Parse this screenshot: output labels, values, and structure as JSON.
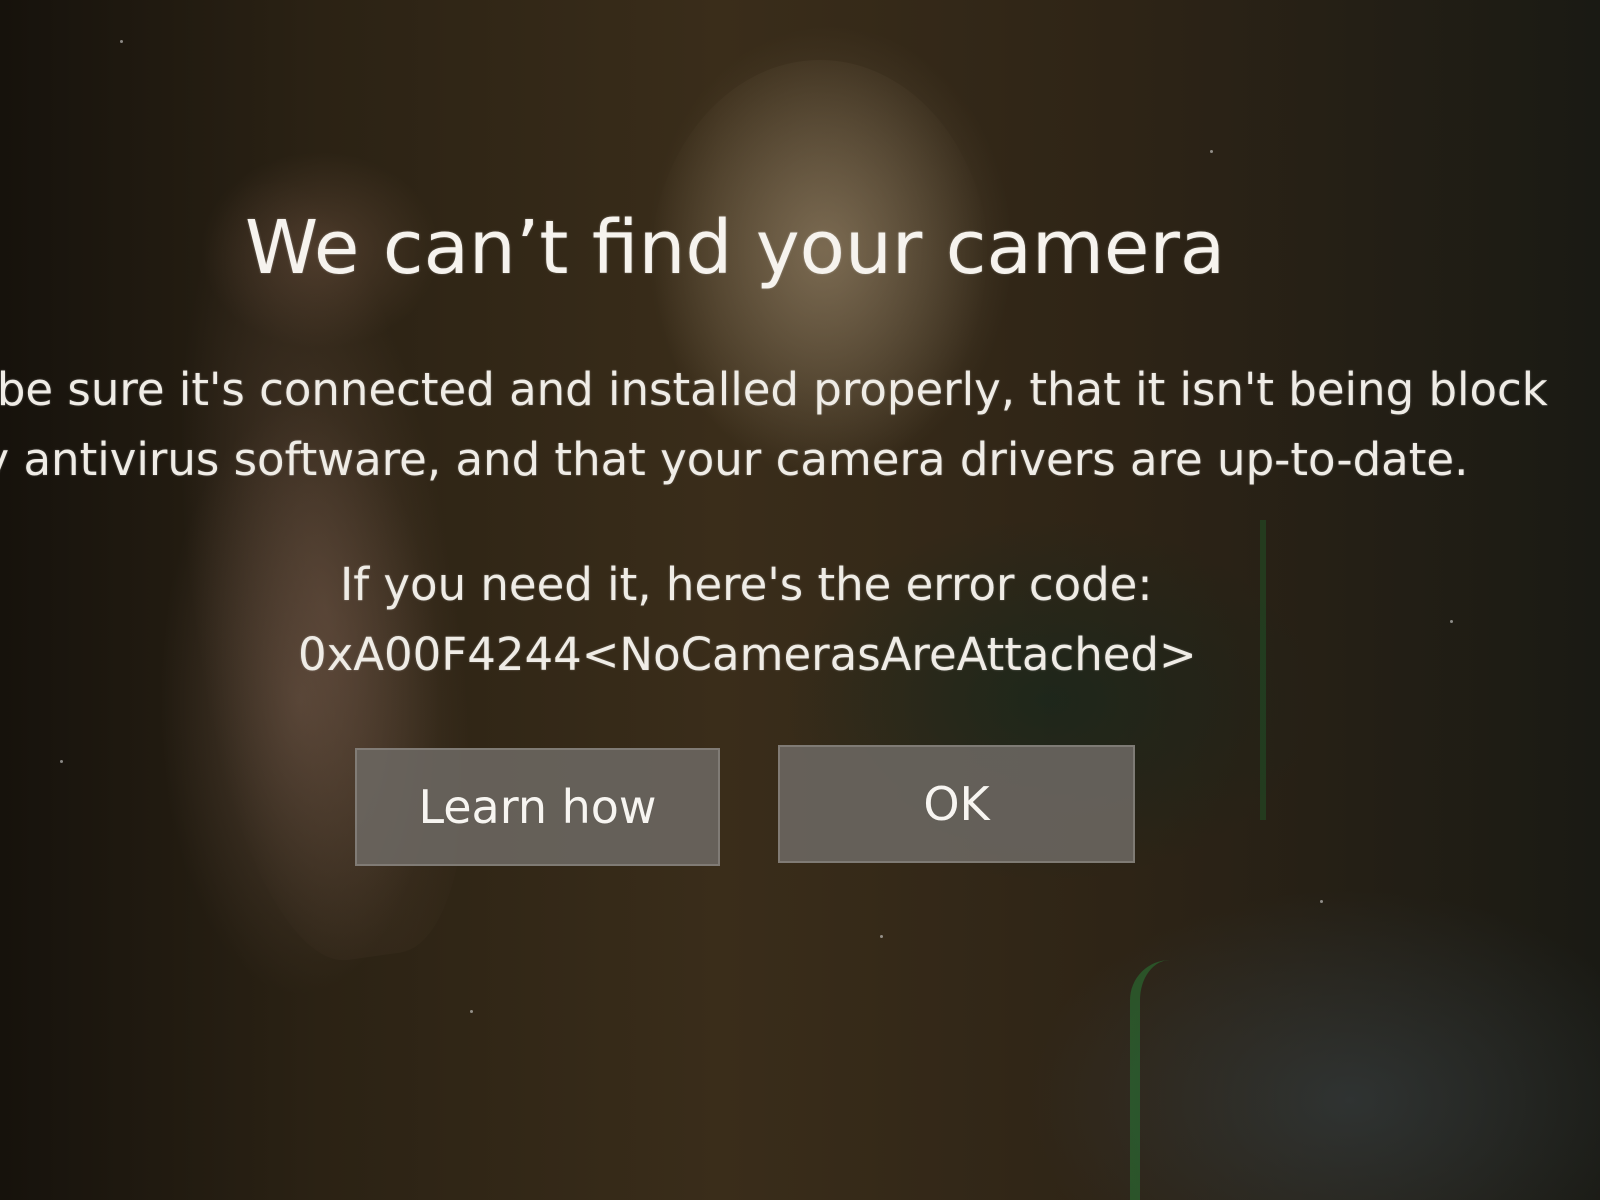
{
  "dialog": {
    "title": "We can’t find your camera",
    "body_lines": [
      "o be sure it's connected and installed properly, that it isn't being block",
      "oy antivirus software, and that your camera drivers are up-to-date."
    ],
    "error_intro": "If you need it, here's the error code:",
    "error_code": "0xA00F4244<NoCamerasAreAttached>"
  },
  "buttons": {
    "learn_how": "Learn how",
    "ok": "OK"
  }
}
